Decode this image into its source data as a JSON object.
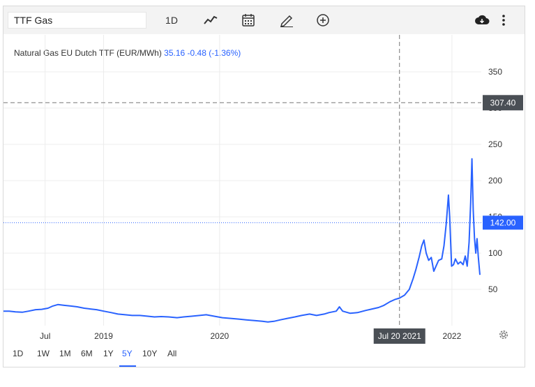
{
  "toolbar": {
    "symbol": "TTF Gas",
    "interval": "1D",
    "icons": [
      "line-chart-icon",
      "calendar-icon",
      "pencil-icon",
      "plus-circle-icon",
      "cloud-download-icon",
      "more-icon"
    ]
  },
  "legend": {
    "name": "Natural Gas EU Dutch TTF (EUR/MWh)",
    "last": "35.16",
    "change": "-0.48",
    "change_pct": "(-1.36%)"
  },
  "ranges": {
    "items": [
      "1D",
      "1W",
      "1M",
      "6M",
      "1Y",
      "5Y",
      "10Y",
      "All"
    ],
    "active": "5Y"
  },
  "crosshair": {
    "price_label": "307.40",
    "time_label": "Jul 20 2021"
  },
  "current_price_label": "142.00",
  "colors": {
    "line": "#2962ff",
    "crosshair_label": "#4a4f55",
    "price_label": "#2962ff"
  },
  "chart_data": {
    "type": "line",
    "title": "Natural Gas EU Dutch TTF (EUR/MWh)",
    "xlabel": "",
    "ylabel": "",
    "x_tick_labels": [
      "Jul",
      "2019",
      "2020",
      "Jul 20 2021",
      "2022"
    ],
    "y_ticks": [
      50,
      100,
      150,
      200,
      250,
      300,
      350
    ],
    "ylim": [
      0,
      370
    ],
    "xlim": [
      "2018-02-20",
      "2022-03-30"
    ],
    "grid": true,
    "series": [
      {
        "values": [
          [
            "2018-02-20",
            20
          ],
          [
            "2018-03-10",
            20
          ],
          [
            "2018-03-30",
            19
          ],
          [
            "2018-04-20",
            18.5
          ],
          [
            "2018-05-10",
            20
          ],
          [
            "2018-06-01",
            22
          ],
          [
            "2018-06-20",
            22.5
          ],
          [
            "2018-07-10",
            24
          ],
          [
            "2018-07-25",
            27
          ],
          [
            "2018-08-10",
            29
          ],
          [
            "2018-08-30",
            28
          ],
          [
            "2018-09-20",
            27
          ],
          [
            "2018-10-10",
            26
          ],
          [
            "2018-11-01",
            24
          ],
          [
            "2018-11-20",
            23
          ],
          [
            "2018-12-10",
            22
          ],
          [
            "2019-01-01",
            20
          ],
          [
            "2019-01-25",
            18
          ],
          [
            "2019-02-15",
            16
          ],
          [
            "2019-03-10",
            15
          ],
          [
            "2019-04-01",
            14
          ],
          [
            "2019-04-25",
            14
          ],
          [
            "2019-05-20",
            13
          ],
          [
            "2019-06-10",
            12
          ],
          [
            "2019-07-01",
            12.5
          ],
          [
            "2019-07-25",
            12
          ],
          [
            "2019-08-20",
            11
          ],
          [
            "2019-09-10",
            12
          ],
          [
            "2019-10-05",
            13
          ],
          [
            "2019-10-30",
            14
          ],
          [
            "2019-11-20",
            15
          ],
          [
            "2019-12-15",
            13
          ],
          [
            "2020-01-10",
            11
          ],
          [
            "2020-02-05",
            10
          ],
          [
            "2020-03-01",
            9
          ],
          [
            "2020-03-25",
            8
          ],
          [
            "2020-04-20",
            7
          ],
          [
            "2020-05-15",
            6
          ],
          [
            "2020-06-01",
            5
          ],
          [
            "2020-06-20",
            6
          ],
          [
            "2020-07-10",
            8
          ],
          [
            "2020-08-01",
            10
          ],
          [
            "2020-08-25",
            12
          ],
          [
            "2020-09-15",
            14
          ],
          [
            "2020-10-10",
            16
          ],
          [
            "2020-11-01",
            14
          ],
          [
            "2020-11-25",
            16
          ],
          [
            "2020-12-10",
            18
          ],
          [
            "2021-01-02",
            20
          ],
          [
            "2021-01-12",
            26
          ],
          [
            "2021-01-22",
            20
          ],
          [
            "2021-02-15",
            17
          ],
          [
            "2021-03-10",
            18
          ],
          [
            "2021-04-05",
            21
          ],
          [
            "2021-04-25",
            23
          ],
          [
            "2021-05-15",
            25
          ],
          [
            "2021-06-01",
            28
          ],
          [
            "2021-06-20",
            33
          ],
          [
            "2021-07-05",
            36
          ],
          [
            "2021-07-20",
            38
          ],
          [
            "2021-08-05",
            42
          ],
          [
            "2021-08-20",
            50
          ],
          [
            "2021-09-01",
            65
          ],
          [
            "2021-09-10",
            78
          ],
          [
            "2021-09-20",
            95
          ],
          [
            "2021-09-28",
            110
          ],
          [
            "2021-10-05",
            118
          ],
          [
            "2021-10-12",
            100
          ],
          [
            "2021-10-20",
            90
          ],
          [
            "2021-10-28",
            94
          ],
          [
            "2021-11-05",
            75
          ],
          [
            "2021-11-12",
            82
          ],
          [
            "2021-11-20",
            90
          ],
          [
            "2021-11-30",
            92
          ],
          [
            "2021-12-07",
            110
          ],
          [
            "2021-12-14",
            140
          ],
          [
            "2021-12-21",
            180
          ],
          [
            "2021-12-25",
            150
          ],
          [
            "2021-12-31",
            82
          ],
          [
            "2022-01-06",
            84
          ],
          [
            "2022-01-12",
            92
          ],
          [
            "2022-01-20",
            85
          ],
          [
            "2022-01-28",
            88
          ],
          [
            "2022-02-05",
            84
          ],
          [
            "2022-02-12",
            96
          ],
          [
            "2022-02-18",
            82
          ],
          [
            "2022-02-24",
            115
          ],
          [
            "2022-03-01",
            170
          ],
          [
            "2022-03-05",
            230
          ],
          [
            "2022-03-09",
            160
          ],
          [
            "2022-03-13",
            120
          ],
          [
            "2022-03-17",
            100
          ],
          [
            "2022-03-21",
            120
          ],
          [
            "2022-03-25",
            95
          ],
          [
            "2022-03-30",
            70
          ]
        ]
      }
    ]
  }
}
